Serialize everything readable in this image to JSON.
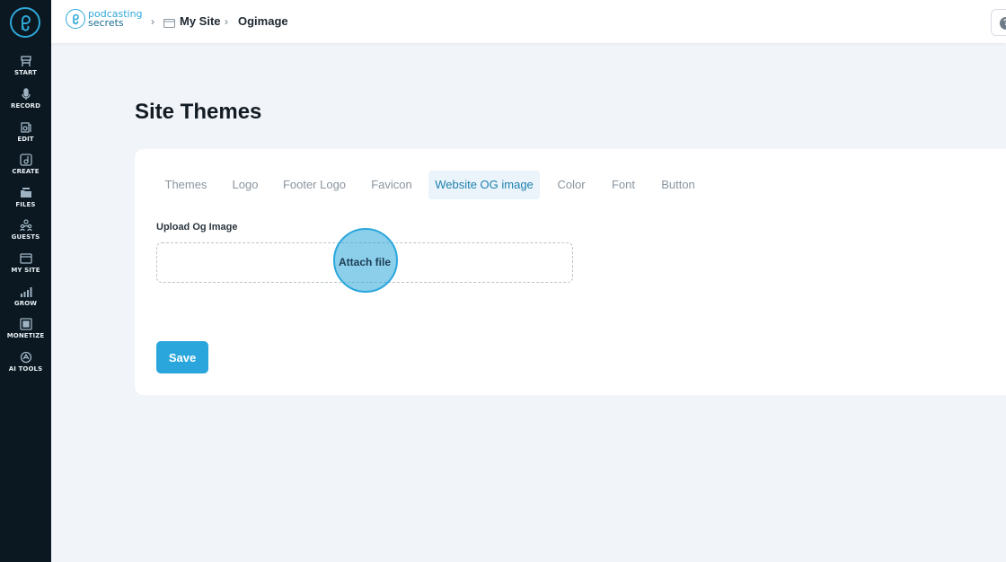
{
  "sidebar": {
    "items": [
      {
        "label": "START",
        "icon": "start-icon"
      },
      {
        "label": "RECORD",
        "icon": "microphone-icon"
      },
      {
        "label": "EDIT",
        "icon": "edit-icon"
      },
      {
        "label": "CREATE",
        "icon": "music-note-icon"
      },
      {
        "label": "FILES",
        "icon": "folder-icon"
      },
      {
        "label": "GUESTS",
        "icon": "guests-icon"
      },
      {
        "label": "MY SITE",
        "icon": "site-icon"
      },
      {
        "label": "GROW",
        "icon": "chart-icon"
      },
      {
        "label": "MONETIZE",
        "icon": "monetize-icon"
      },
      {
        "label": "AI TOOLS",
        "icon": "ai-icon"
      }
    ]
  },
  "header": {
    "brand_line1": "podcasting",
    "brand_line2": "secrets",
    "breadcrumb": [
      "My Site",
      "Ogimage"
    ],
    "help_label": "?"
  },
  "main": {
    "title": "Site Themes",
    "tabs": [
      {
        "label": "Themes"
      },
      {
        "label": "Logo"
      },
      {
        "label": "Footer Logo"
      },
      {
        "label": "Favicon"
      },
      {
        "label": "Website OG image",
        "active": true
      },
      {
        "label": "Color"
      },
      {
        "label": "Font"
      },
      {
        "label": "Button"
      }
    ],
    "upload_label": "Upload Og Image",
    "attach_label": "Attach file",
    "save_label": "Save"
  },
  "colors": {
    "accent": "#2aa6dc",
    "sidebar_bg": "#0b1821",
    "page_bg": "#f1f4f8"
  }
}
